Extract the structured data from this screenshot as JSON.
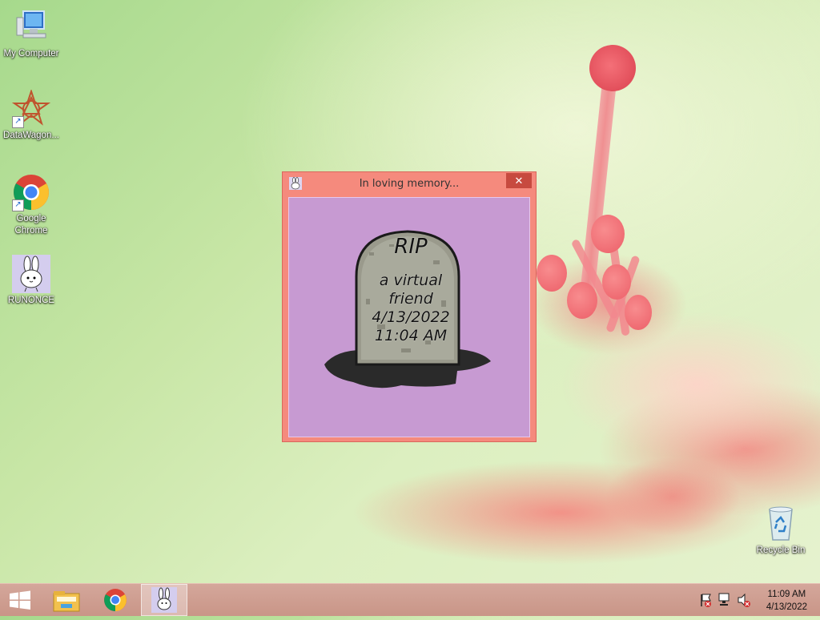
{
  "desktop": {
    "icons": [
      {
        "label": "My Computer",
        "icon": "my-computer-icon"
      },
      {
        "label": "DataWagon...",
        "icon": "datawagon-icon"
      },
      {
        "label": "Google Chrome",
        "icon": "chrome-icon"
      },
      {
        "label": "RUNONCE",
        "icon": "bunny-icon"
      },
      {
        "label": "Recycle Bin",
        "icon": "recycle-bin-icon"
      }
    ]
  },
  "window": {
    "title": "In loving memory...",
    "close_label": "✕",
    "background": "#c79ad2",
    "tombstone": {
      "line1": "RIP",
      "line2": "a virtual",
      "line3": "friend",
      "line4": "4/13/2022",
      "line5": "11:04 AM"
    }
  },
  "taskbar": {
    "start_icon": "windows-start-icon",
    "pinned": [
      "file-explorer-icon",
      "chrome-icon",
      "bunny-app-icon"
    ],
    "tray_icons": [
      "action-center-flag-icon",
      "network-icon",
      "volume-muted-icon"
    ],
    "clock": {
      "time": "11:09 AM",
      "date": "4/13/2022"
    }
  },
  "colors": {
    "window_frame": "#f58a7d",
    "close_button": "#c74a3f",
    "taskbar": "#cd9a8c"
  }
}
